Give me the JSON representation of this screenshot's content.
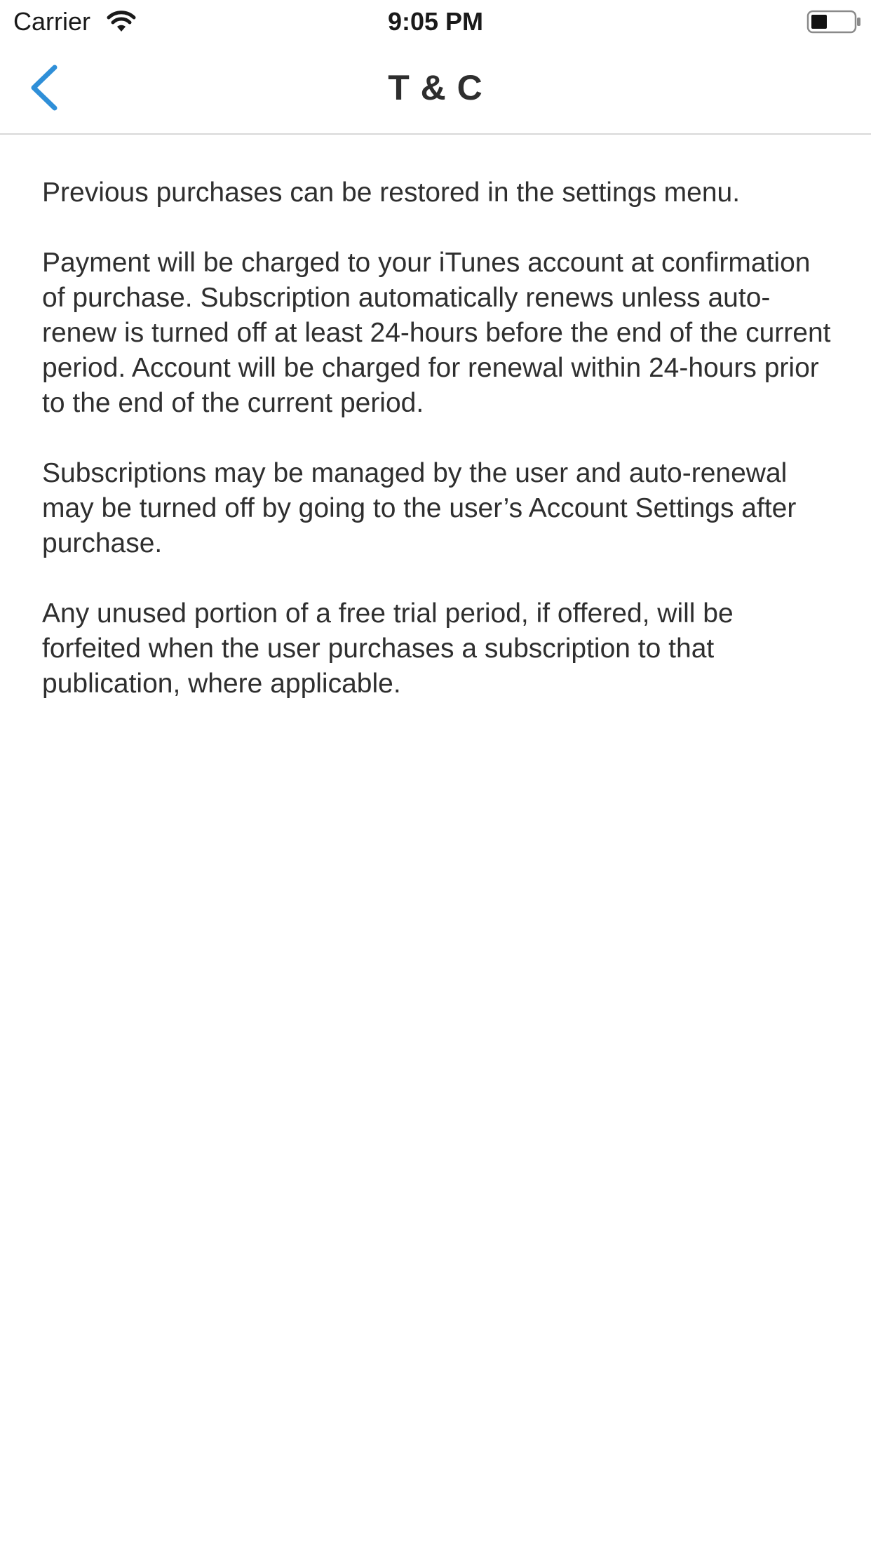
{
  "status_bar": {
    "carrier": "Carrier",
    "time": "9:05 PM",
    "wifi_icon": "wifi-icon",
    "battery_icon": "battery-icon"
  },
  "nav": {
    "title": "T & C",
    "back_icon": "chevron-left-icon",
    "accent_color": "#2f8fd8"
  },
  "content": {
    "paragraphs": [
      "Previous purchases can be restored in the settings menu.",
      "Payment will be charged to your iTunes account at confirmation of purchase. Subscription automatically renews unless auto-renew is turned off at least 24-hours before the end of the current period. Account will be charged for renewal within 24-hours prior to the end of the current period.",
      "Subscriptions may be managed by the user and auto-renewal may be turned off by going to the user’s Account Settings after purchase.",
      "Any unused portion of a free trial period, if offered, will be forfeited when the user purchases a subscription to that publication, where applicable."
    ]
  }
}
